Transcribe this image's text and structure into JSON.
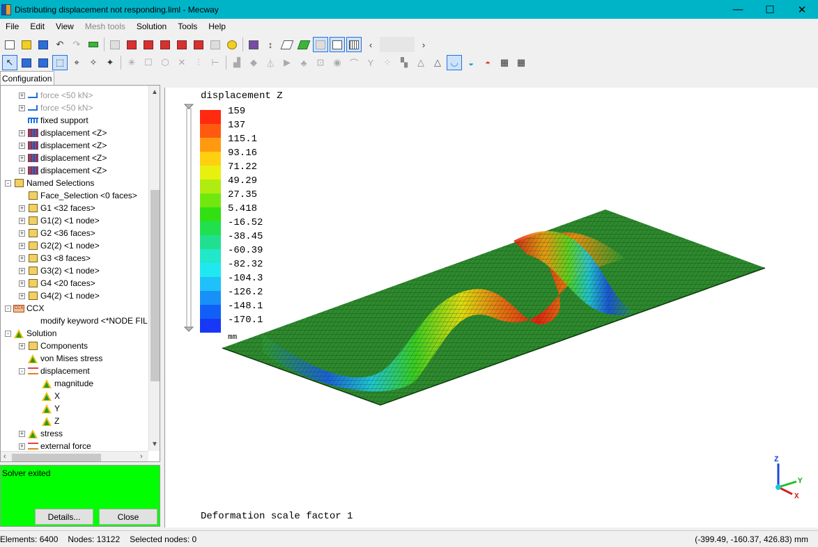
{
  "window": {
    "title": "Distributing displacement not responding.liml - Mecway",
    "minimize": "—",
    "maximize": "☐",
    "close": "✕"
  },
  "menu": [
    "File",
    "Edit",
    "View",
    "Mesh tools",
    "Solution",
    "Tools",
    "Help"
  ],
  "menu_disabled": [
    "Mesh tools"
  ],
  "config_tab": "Configuration",
  "tree": [
    {
      "label": "force <50 kN>",
      "indent": 1,
      "icon": "force-icon",
      "exp": "+",
      "dim": true
    },
    {
      "label": "force <50 kN>",
      "indent": 1,
      "icon": "force-icon",
      "exp": "+",
      "dim": true
    },
    {
      "label": "fixed support",
      "indent": 1,
      "icon": "fixed-support-icon",
      "exp": ""
    },
    {
      "label": "displacement <Z>",
      "indent": 1,
      "icon": "displacement-constraint-icon",
      "exp": "+"
    },
    {
      "label": "displacement <Z>",
      "indent": 1,
      "icon": "displacement-constraint-icon",
      "exp": "+"
    },
    {
      "label": "displacement <Z>",
      "indent": 1,
      "icon": "displacement-constraint-icon",
      "exp": "+"
    },
    {
      "label": "displacement <Z>",
      "indent": 1,
      "icon": "displacement-constraint-icon",
      "exp": "+"
    },
    {
      "label": "Named Selections",
      "indent": 0,
      "icon": "named-selection-icon",
      "exp": "-"
    },
    {
      "label": "Face_Selection <0 faces>",
      "indent": 1,
      "icon": "selection-box-icon",
      "exp": ""
    },
    {
      "label": "G1 <32 faces>",
      "indent": 1,
      "icon": "selection-box-icon",
      "exp": "+"
    },
    {
      "label": "G1(2) <1 node>",
      "indent": 1,
      "icon": "selection-box-icon",
      "exp": "+"
    },
    {
      "label": "G2 <36 faces>",
      "indent": 1,
      "icon": "selection-box-icon",
      "exp": "+"
    },
    {
      "label": "G2(2) <1 node>",
      "indent": 1,
      "icon": "selection-box-icon",
      "exp": "+"
    },
    {
      "label": "G3 <8 faces>",
      "indent": 1,
      "icon": "selection-box-icon",
      "exp": "+"
    },
    {
      "label": "G3(2) <1 node>",
      "indent": 1,
      "icon": "selection-box-icon",
      "exp": "+"
    },
    {
      "label": "G4 <20 faces>",
      "indent": 1,
      "icon": "selection-box-icon",
      "exp": "+"
    },
    {
      "label": "G4(2) <1 node>",
      "indent": 1,
      "icon": "selection-box-icon",
      "exp": "+"
    },
    {
      "label": "CCX",
      "indent": 0,
      "icon": "ccx-icon",
      "exp": "-"
    },
    {
      "label": "modify keyword <*NODE FIL",
      "indent": 1,
      "icon": "",
      "exp": ""
    },
    {
      "label": "Solution",
      "indent": 0,
      "icon": "solution-icon",
      "exp": "-"
    },
    {
      "label": "Components",
      "indent": 1,
      "icon": "components-icon",
      "exp": "+"
    },
    {
      "label": "von Mises stress",
      "indent": 1,
      "icon": "result-icon",
      "exp": ""
    },
    {
      "label": "displacement",
      "indent": 1,
      "icon": "displacement-result-icon",
      "exp": "-"
    },
    {
      "label": "magnitude",
      "indent": 2,
      "icon": "result-icon",
      "exp": ""
    },
    {
      "label": "X",
      "indent": 2,
      "icon": "result-icon",
      "exp": ""
    },
    {
      "label": "Y",
      "indent": 2,
      "icon": "result-icon",
      "exp": ""
    },
    {
      "label": "Z",
      "indent": 2,
      "icon": "result-icon",
      "exp": ""
    },
    {
      "label": "stress",
      "indent": 1,
      "icon": "result-icon",
      "exp": "+"
    },
    {
      "label": "external force",
      "indent": 1,
      "icon": "displacement-result-icon",
      "exp": "+"
    }
  ],
  "solver": {
    "message": "Solver exited",
    "details_label": "Details...",
    "close_label": "Close",
    "bg_color": "#00ff00"
  },
  "viewport": {
    "result_title": "displacement Z",
    "unit": "mm",
    "footer": "Deformation scale factor 1",
    "legend_values": [
      "159",
      "137",
      "115.1",
      "93.16",
      "71.22",
      "49.29",
      "27.35",
      "5.418",
      "-16.52",
      "-38.45",
      "-60.39",
      "-82.32",
      "-104.3",
      "-126.2",
      "-148.1",
      "-170.1"
    ],
    "legend_colors": [
      "#ff2a10",
      "#ff5a10",
      "#ff9a10",
      "#ffd010",
      "#e8f010",
      "#b0ec10",
      "#70e810",
      "#30e010",
      "#20e050",
      "#20e090",
      "#20e8c8",
      "#20e8f0",
      "#20c0f8",
      "#1890f8",
      "#1060f8",
      "#1838f8"
    ],
    "axis_labels": {
      "z": "Z",
      "y": "Y",
      "x": "X"
    }
  },
  "status": {
    "elements": "Elements: 6400",
    "nodes": "Nodes: 13122",
    "selected": "Selected nodes: 0",
    "coords": "(-399.49, -160.37, 426.83) mm"
  }
}
